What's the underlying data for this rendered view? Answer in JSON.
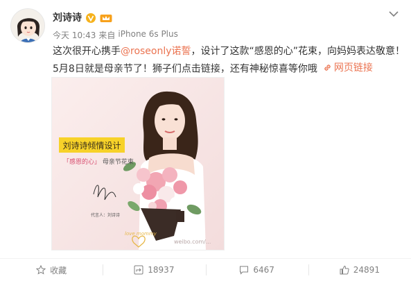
{
  "post": {
    "user_name": "刘诗诗",
    "meta": {
      "time": "今天 10:43",
      "source_prefix": "来自",
      "device": "iPhone 6s Plus"
    },
    "text_line1": {
      "before": "这次很开心携手",
      "mention": "@roseonly诺誓",
      "after": "，设计了这款“感恩的心”花束，向妈妈表达敬意！"
    },
    "text_line2": {
      "text": "5月8日就是母亲节了！狮子们点击链接，还有神秘惊喜等你哦",
      "link_label": "网页链接"
    },
    "image": {
      "banner": "刘诗诗倾情设计",
      "caption_highlight": "「感恩的心」",
      "caption_rest": "母亲节花束",
      "sign_caption": "代言人：刘诗诗",
      "love_mark": "love mommy",
      "watermark": "weibo.com/..."
    }
  },
  "actions": {
    "favorite_label": "收藏",
    "repost_count": "18937",
    "comment_count": "6467",
    "like_count": "24891"
  },
  "colors": {
    "link": "#eb7350",
    "banner": "#f7d229",
    "muted": "#808080"
  }
}
